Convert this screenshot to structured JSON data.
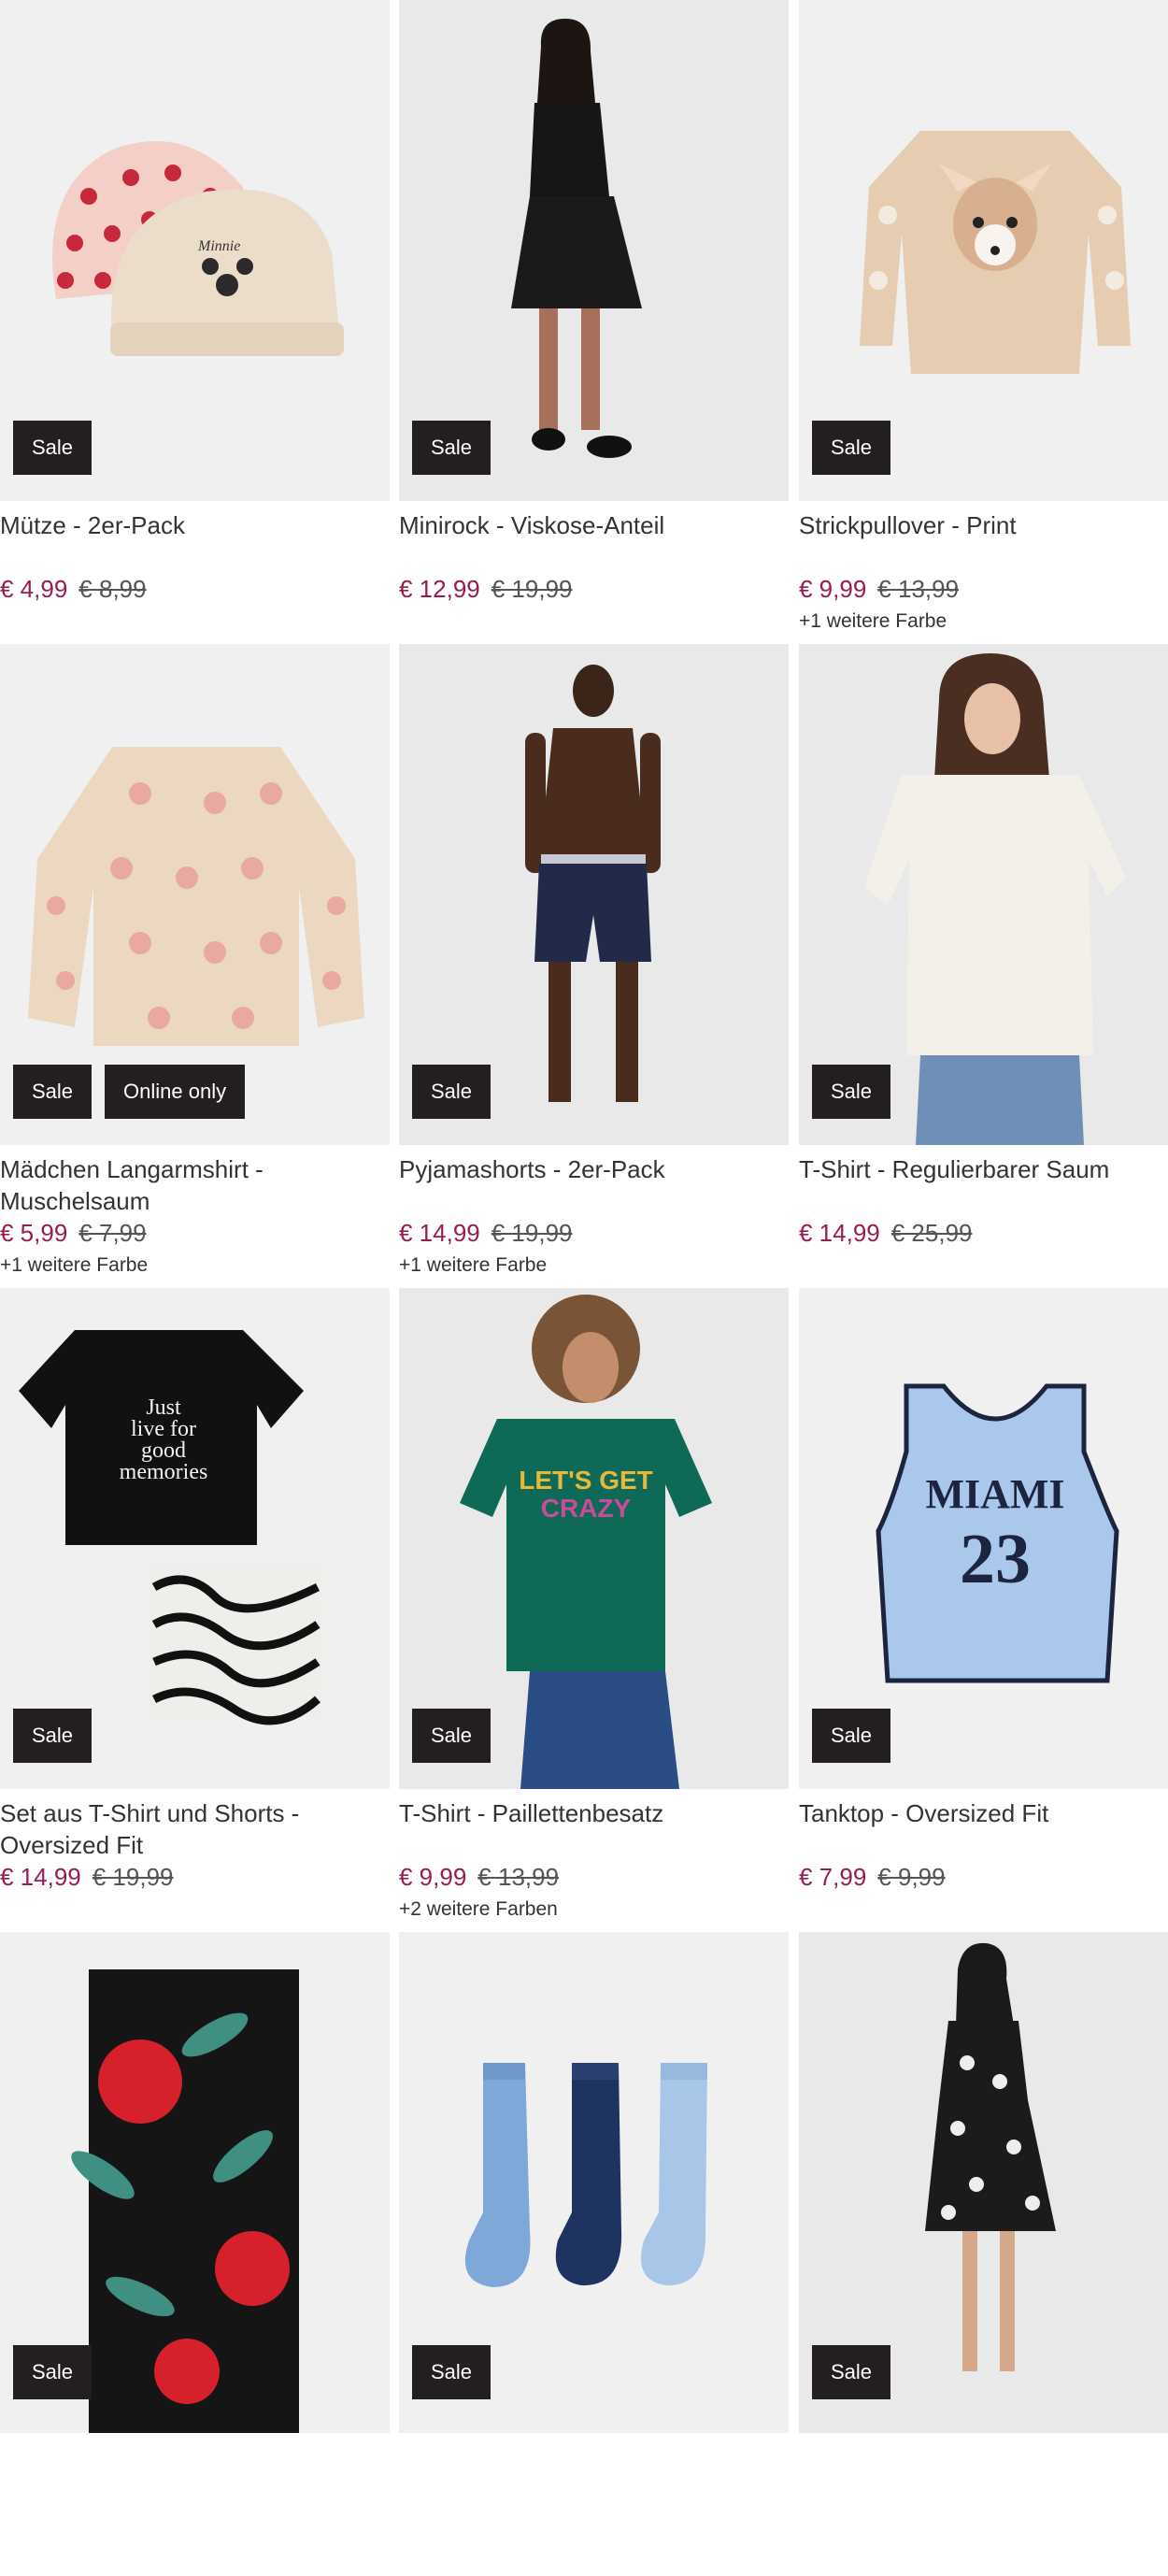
{
  "colors": {
    "sale_badge_bg": "#231f1e",
    "price_sale": "#9a1b52",
    "image_bg": "#f0f0f0"
  },
  "products": [
    {
      "title": "Mütze - 2er-Pack",
      "price": "€ 4,99",
      "old_price": "€ 8,99",
      "badges": [
        "Sale"
      ],
      "more_colors": ""
    },
    {
      "title": "Minirock - Viskose-Anteil",
      "price": "€ 12,99",
      "old_price": "€ 19,99",
      "badges": [
        "Sale"
      ],
      "more_colors": ""
    },
    {
      "title": "Strickpullover - Print",
      "price": "€ 9,99",
      "old_price": "€ 13,99",
      "badges": [
        "Sale"
      ],
      "more_colors": "+1 weitere Farbe"
    },
    {
      "title": "Mädchen Langarmshirt - Muschelsaum",
      "price": "€ 5,99",
      "old_price": "€ 7,99",
      "badges": [
        "Sale",
        "Online only"
      ],
      "more_colors": "+1 weitere Farbe"
    },
    {
      "title": "Pyjamashorts - 2er-Pack",
      "price": "€ 14,99",
      "old_price": "€ 19,99",
      "badges": [
        "Sale"
      ],
      "more_colors": "+1 weitere Farbe"
    },
    {
      "title": "T-Shirt - Regulierbarer Saum",
      "price": "€ 14,99",
      "old_price": "€ 25,99",
      "badges": [
        "Sale"
      ],
      "more_colors": ""
    },
    {
      "title": "Set aus T-Shirt und Shorts - Oversized Fit",
      "price": "€ 14,99",
      "old_price": "€ 19,99",
      "badges": [
        "Sale"
      ],
      "more_colors": ""
    },
    {
      "title": "T-Shirt - Paillettenbesatz",
      "price": "€ 9,99",
      "old_price": "€ 13,99",
      "badges": [
        "Sale"
      ],
      "more_colors": "+2 weitere Farben"
    },
    {
      "title": "Tanktop - Oversized Fit",
      "price": "€ 7,99",
      "old_price": "€ 9,99",
      "badges": [
        "Sale"
      ],
      "more_colors": ""
    },
    {
      "title": "",
      "price": "",
      "old_price": "",
      "badges": [
        "Sale"
      ],
      "more_colors": ""
    },
    {
      "title": "",
      "price": "",
      "old_price": "",
      "badges": [
        "Sale"
      ],
      "more_colors": ""
    },
    {
      "title": "",
      "price": "",
      "old_price": "",
      "badges": [
        "Sale"
      ],
      "more_colors": ""
    }
  ],
  "print_texts": {
    "minnie": "Minnie",
    "tee_slogan": [
      "Just",
      "live for",
      "good",
      "memories"
    ],
    "crazy_slogan": [
      "LET'S GET",
      "CRAZY"
    ],
    "jersey_city": "MIAMI",
    "jersey_number": "23"
  }
}
